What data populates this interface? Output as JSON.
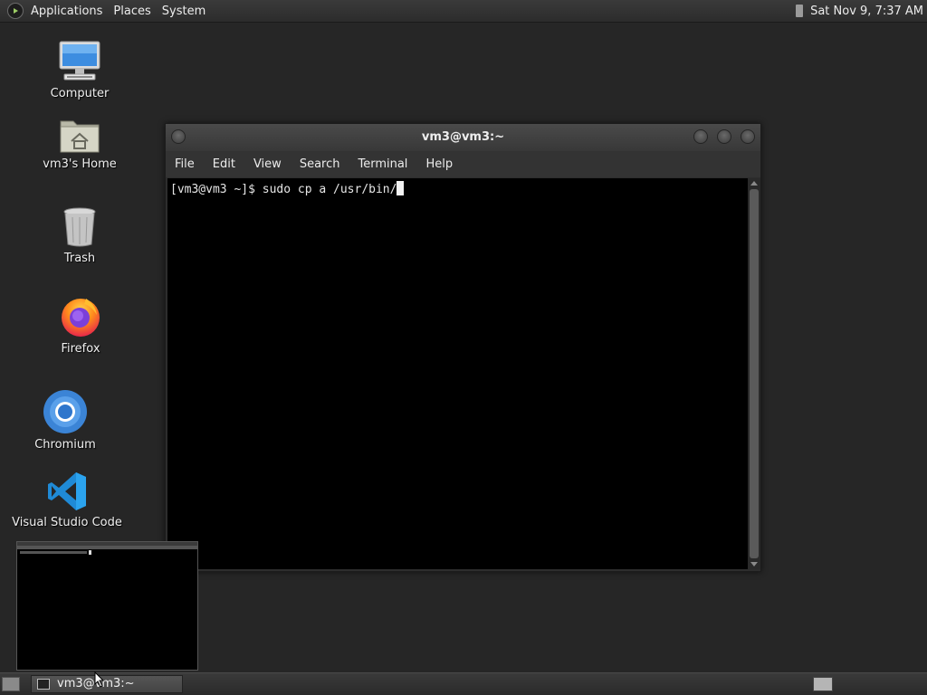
{
  "top_panel": {
    "menus": [
      "Applications",
      "Places",
      "System"
    ],
    "clock": "Sat Nov 9,  7:37 AM"
  },
  "desktop_icons": [
    {
      "label": "Computer",
      "icon": "computer-icon"
    },
    {
      "label": "vm3's Home",
      "icon": "home-folder-icon"
    },
    {
      "label": "Trash",
      "icon": "trash-icon"
    },
    {
      "label": "Firefox",
      "icon": "firefox-icon"
    },
    {
      "label": "Chromium",
      "icon": "chromium-icon"
    },
    {
      "label": "Visual Studio Code",
      "icon": "vscode-icon"
    }
  ],
  "terminal": {
    "title": "vm3@vm3:~",
    "menus": [
      "File",
      "Edit",
      "View",
      "Search",
      "Terminal",
      "Help"
    ],
    "prompt_line": "[vm3@vm3 ~]$ sudo cp a /usr/bin/"
  },
  "taskbar": {
    "task_label": "vm3@vm3:~"
  },
  "colors": {
    "desktop_bg": "#262626",
    "terminal_bg": "#000000",
    "panel_bg": "#333333"
  }
}
